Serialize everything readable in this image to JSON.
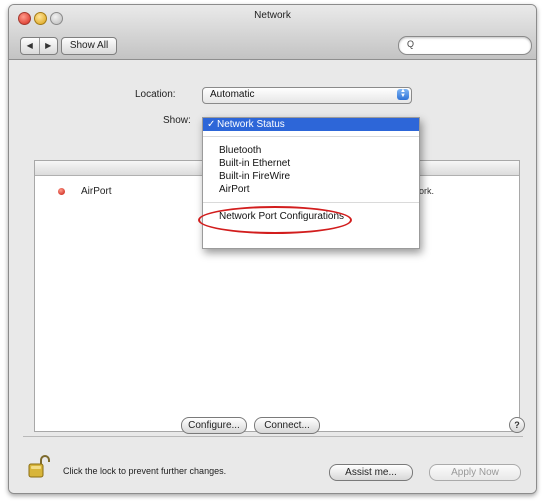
{
  "window": {
    "title": "Network"
  },
  "toolbar": {
    "back_icon": "back-arrow-icon",
    "forward_icon": "forward-arrow-icon",
    "back_glyph": "◀",
    "forward_glyph": "▶",
    "show_all_label": "Show All",
    "search_icon": "magnifier-icon",
    "search_glyph": "Q",
    "search_placeholder": ""
  },
  "location": {
    "label": "Location:",
    "value": "Automatic"
  },
  "show": {
    "label": "Show:"
  },
  "show_menu": {
    "items": [
      {
        "label": "Network Status",
        "selected": true,
        "mark": "✓"
      },
      {
        "label": "Bluetooth"
      },
      {
        "label": "Built-in Ethernet",
        "highlighted_by_annotation": true
      },
      {
        "label": "Built-in FireWire"
      },
      {
        "label": "AirPort"
      },
      {
        "label": "Network Port Configurations"
      }
    ]
  },
  "list": {
    "rows": [
      {
        "name": "AirPort",
        "status_color": "#d81e14",
        "status_text": "etwork."
      }
    ]
  },
  "buttons": {
    "configure": "Configure...",
    "connect": "Connect...",
    "assist": "Assist me...",
    "apply": "Apply Now",
    "help": "?"
  },
  "footer": {
    "lock_text": "Click the lock to prevent further changes."
  },
  "colors": {
    "menu_selection": "#2d66d8",
    "annotation_ellipse": "#d21d1d"
  }
}
